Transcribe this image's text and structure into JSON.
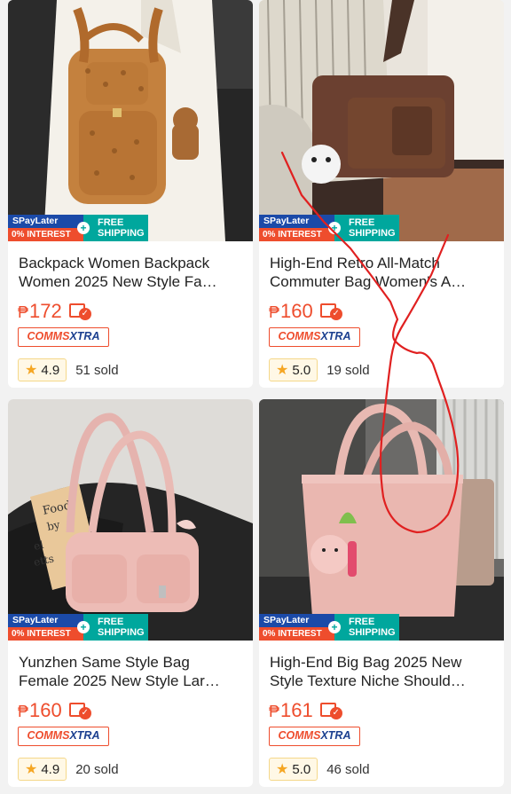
{
  "badges": {
    "spaylater": "SPayLater",
    "interest": "0% INTEREST",
    "free": "FREE",
    "shipping": "SHIPPING",
    "plus": "+"
  },
  "comms": {
    "part1": "COMMS",
    "part2": "XTRA"
  },
  "currency": "₱",
  "star_glyph": "★",
  "voucher_check": "✓",
  "products": [
    {
      "title_line1": "Backpack Women Backpack",
      "title_line2": "Women 2025 New Style Fa…",
      "price": "172",
      "rating": "4.9",
      "sold": "51 sold"
    },
    {
      "title_line1": "High-End Retro All-Match",
      "title_line2": "Commuter Bag Women's A…",
      "price": "160",
      "rating": "5.0",
      "sold": "19 sold"
    },
    {
      "title_line1": "Yunzhen Same Style Bag",
      "title_line2": "Female 2025 New Style Lar…",
      "price": "160",
      "rating": "4.9",
      "sold": "20 sold"
    },
    {
      "title_line1": "High-End Big Bag 2025 New",
      "title_line2": "Style Texture Niche Should…",
      "price": "161",
      "rating": "5.0",
      "sold": "46 sold"
    }
  ],
  "colors": {
    "accent": "#ee4d2d",
    "spaylater_blue": "#1b4aa8",
    "shipping_teal": "#00a79d",
    "star": "#f5a623",
    "scribble": "#e02020"
  },
  "image_labels": {
    "book_text": "Food\nby\nel\netts"
  }
}
